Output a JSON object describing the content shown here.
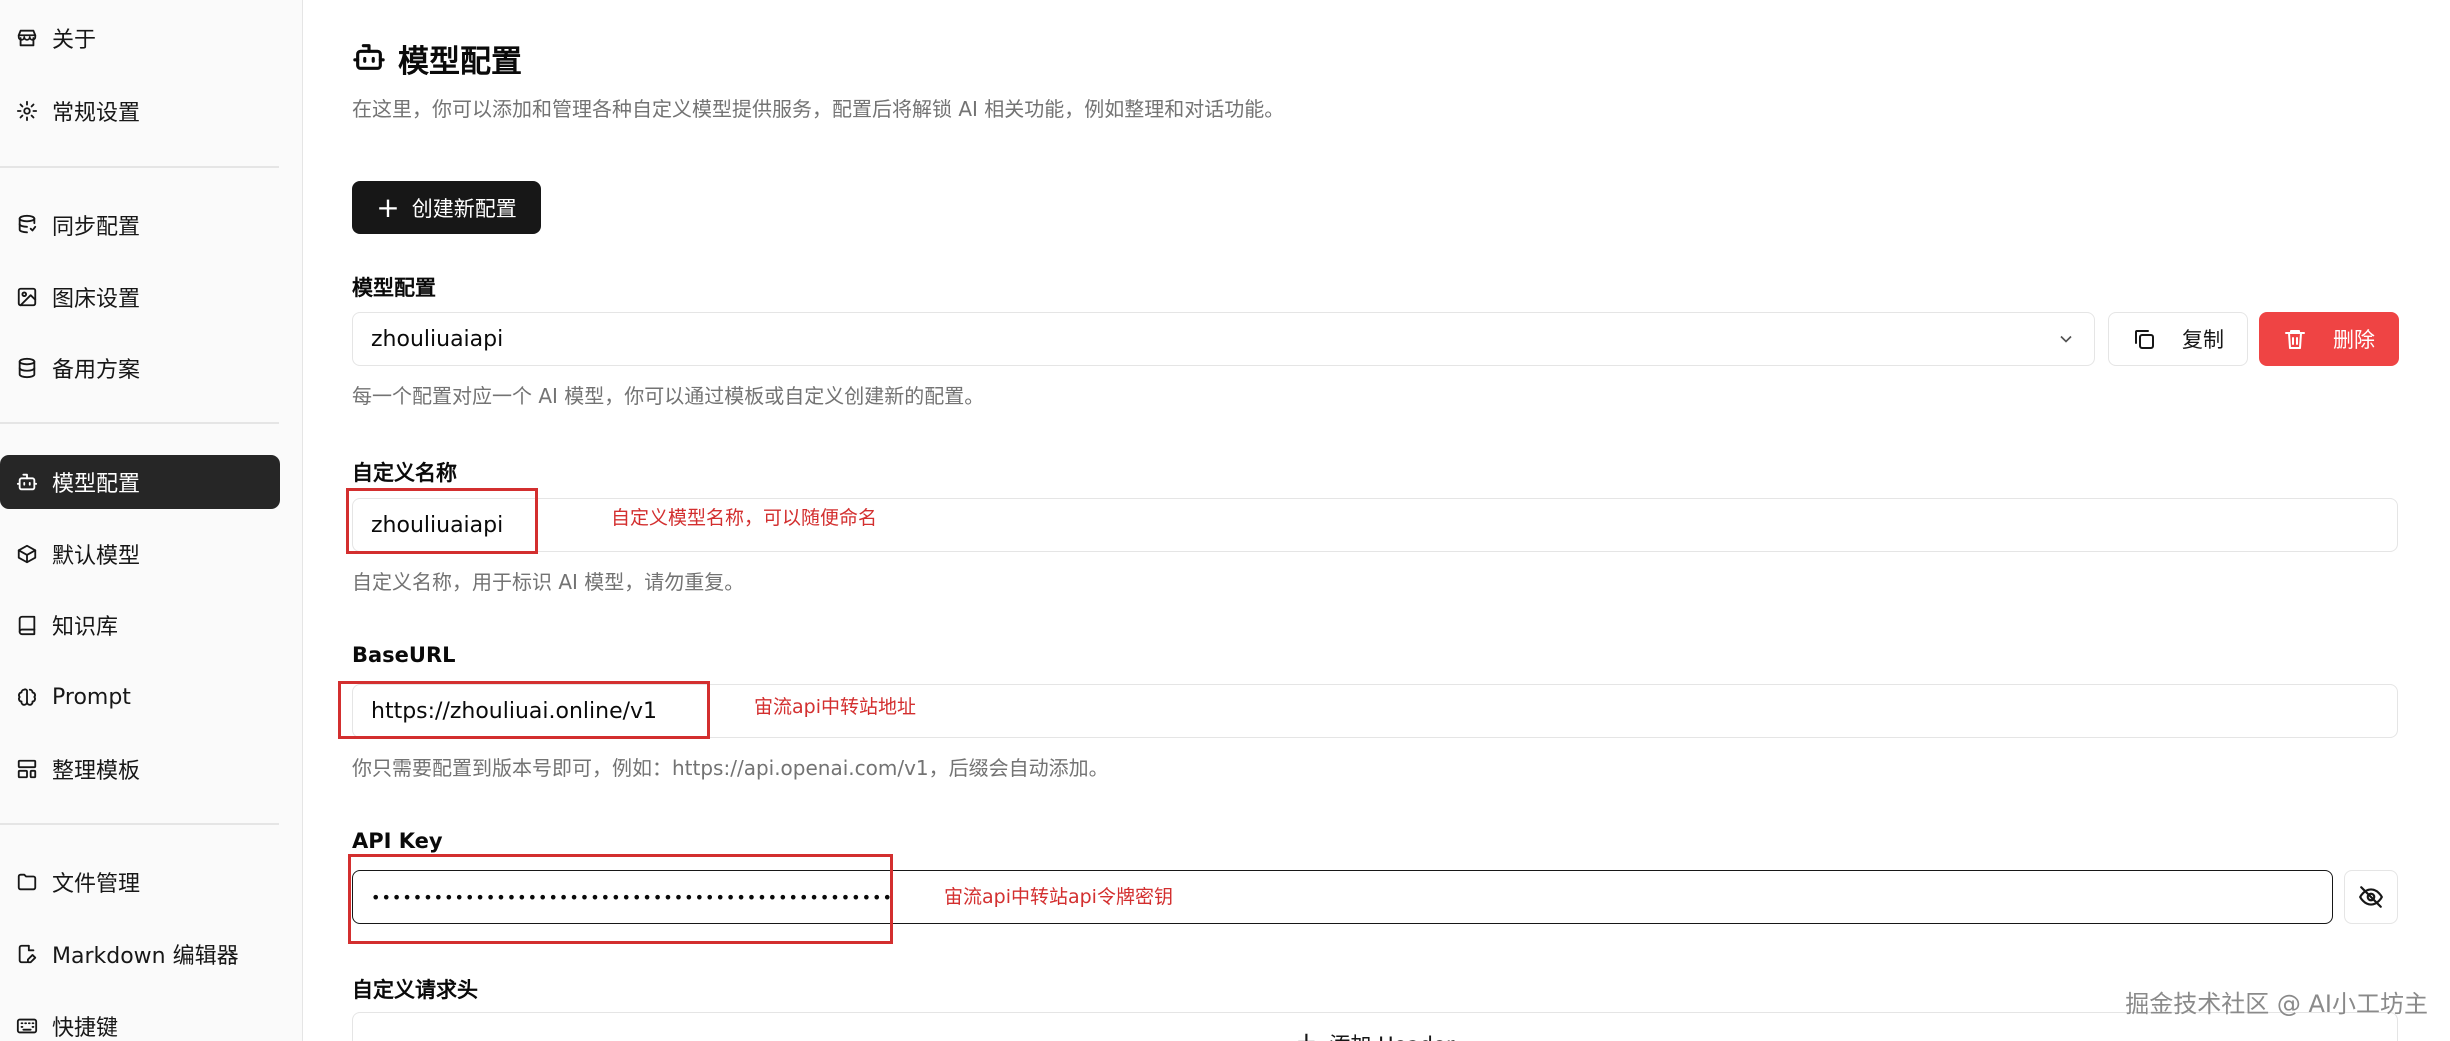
{
  "sidebar": {
    "items": [
      {
        "label": "关于",
        "icon": "store-icon"
      },
      {
        "label": "常规设置",
        "icon": "gear-icon"
      },
      {
        "label": "同步配置",
        "icon": "database-sync-icon"
      },
      {
        "label": "图床设置",
        "icon": "image-icon"
      },
      {
        "label": "备用方案",
        "icon": "database-icon"
      },
      {
        "label": "模型配置",
        "icon": "bot-icon",
        "active": true
      },
      {
        "label": "默认模型",
        "icon": "box-icon"
      },
      {
        "label": "知识库",
        "icon": "book-icon"
      },
      {
        "label": "Prompt",
        "icon": "brain-icon"
      },
      {
        "label": "整理模板",
        "icon": "layout-template-icon"
      },
      {
        "label": "文件管理",
        "icon": "folder-icon"
      },
      {
        "label": "Markdown 编辑器",
        "icon": "file-edit-icon"
      },
      {
        "label": "快捷键",
        "icon": "keyboard-icon"
      }
    ]
  },
  "main": {
    "title": "模型配置",
    "description": "在这里，你可以添加和管理各种自定义模型提供服务，配置后将解锁 AI 相关功能，例如整理和对话功能。",
    "create_button": "创建新配置",
    "model_config": {
      "label": "模型配置",
      "selected": "zhouliuaiapi",
      "copy_button": "复制",
      "delete_button": "删除",
      "help": "每一个配置对应一个 AI 模型，你可以通过模板或自定义创建新的配置。"
    },
    "custom_name": {
      "label": "自定义名称",
      "value": "zhouliuaiapi",
      "help": "自定义名称，用于标识 AI 模型，请勿重复。"
    },
    "base_url": {
      "label": "BaseURL",
      "value": "https://zhouliuai.online/v1",
      "help": "你只需要配置到版本号即可，例如：https://api.openai.com/v1，后缀会自动添加。"
    },
    "api_key": {
      "label": "API Key",
      "value": "••••••••••••••••••••••••••••••••••••••••••••••••••"
    },
    "custom_headers": {
      "label": "自定义请求头",
      "add_button": "添加 Header"
    }
  },
  "annotations": {
    "name_note": "自定义模型名称，可以随便命名",
    "url_note": "宙流api中转站地址",
    "key_note": "宙流api中转站api令牌密钥"
  },
  "watermark": "掘金技术社区 @ AI小工坊主",
  "colors": {
    "active_nav": "#262626",
    "primary_button": "#171717",
    "danger": "#ef4444",
    "annotation": "#d32f2f"
  }
}
